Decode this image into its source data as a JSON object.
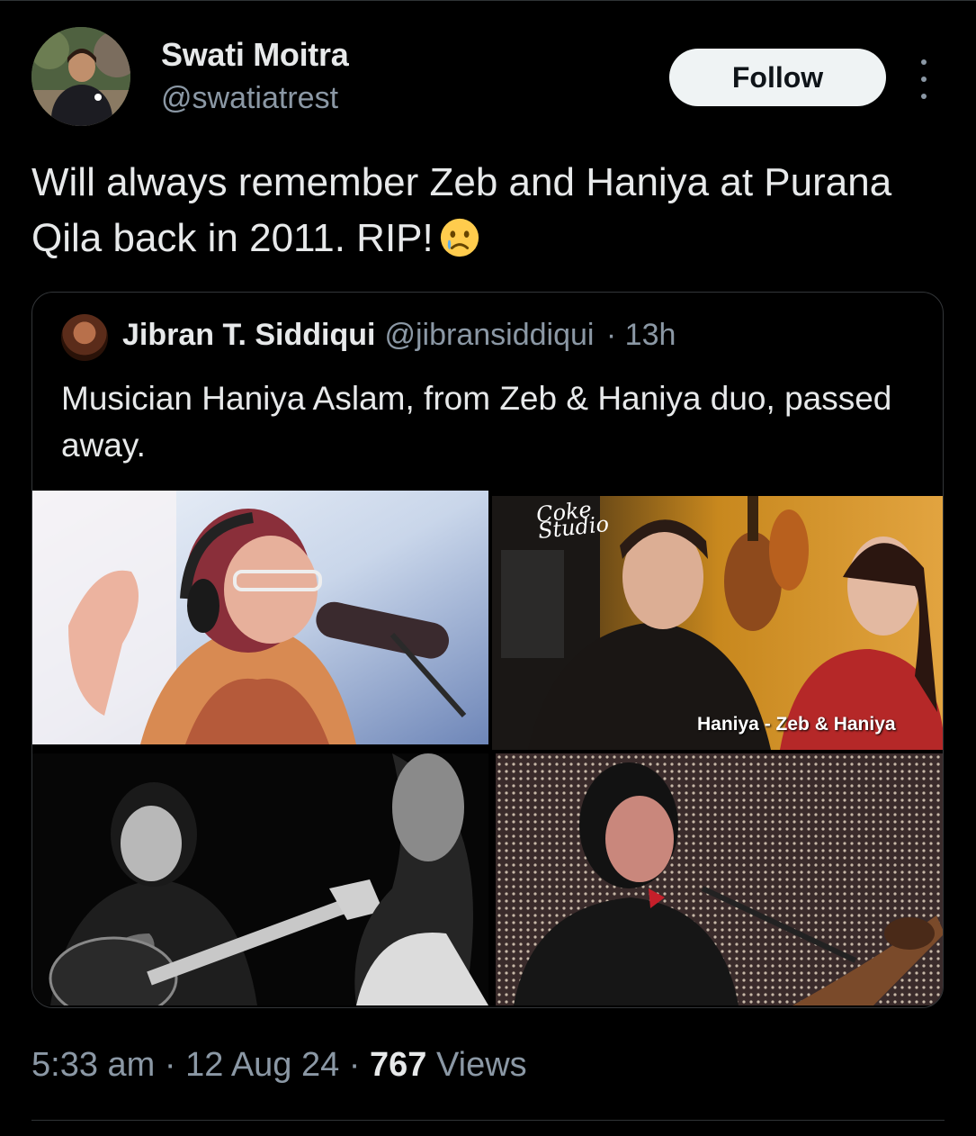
{
  "author": {
    "name": "Swati Moitra",
    "handle": "@swatiatrest",
    "follow_label": "Follow"
  },
  "tweet": {
    "text": "Will always remember Zeb and Haniya at Purana Qila back in 2011. RIP!",
    "emoji": "crying-face"
  },
  "quoted": {
    "name": "Jibran T. Siddiqui",
    "handle": "@jibransiddiqui",
    "time": "· 13h",
    "text": "Musician Haniya Aslam, from Zeb & Haniya duo, passed away.",
    "images": [
      {
        "logo": "",
        "caption": ""
      },
      {
        "logo_top": "Coke",
        "logo_bottom": "Studio",
        "caption": "Haniya - Zeb & Haniya"
      },
      {
        "logo": "",
        "caption": ""
      },
      {
        "logo": "",
        "caption": ""
      }
    ]
  },
  "footer": {
    "time": "5:33 am",
    "date": "· 12 Aug 24 ·",
    "views_count": "767",
    "views_label": "Views"
  },
  "colors": {
    "background": "#000000",
    "text": "#e7e9ea",
    "muted": "#8b98a5",
    "border": "#333639",
    "follow_bg": "#eff3f4"
  }
}
